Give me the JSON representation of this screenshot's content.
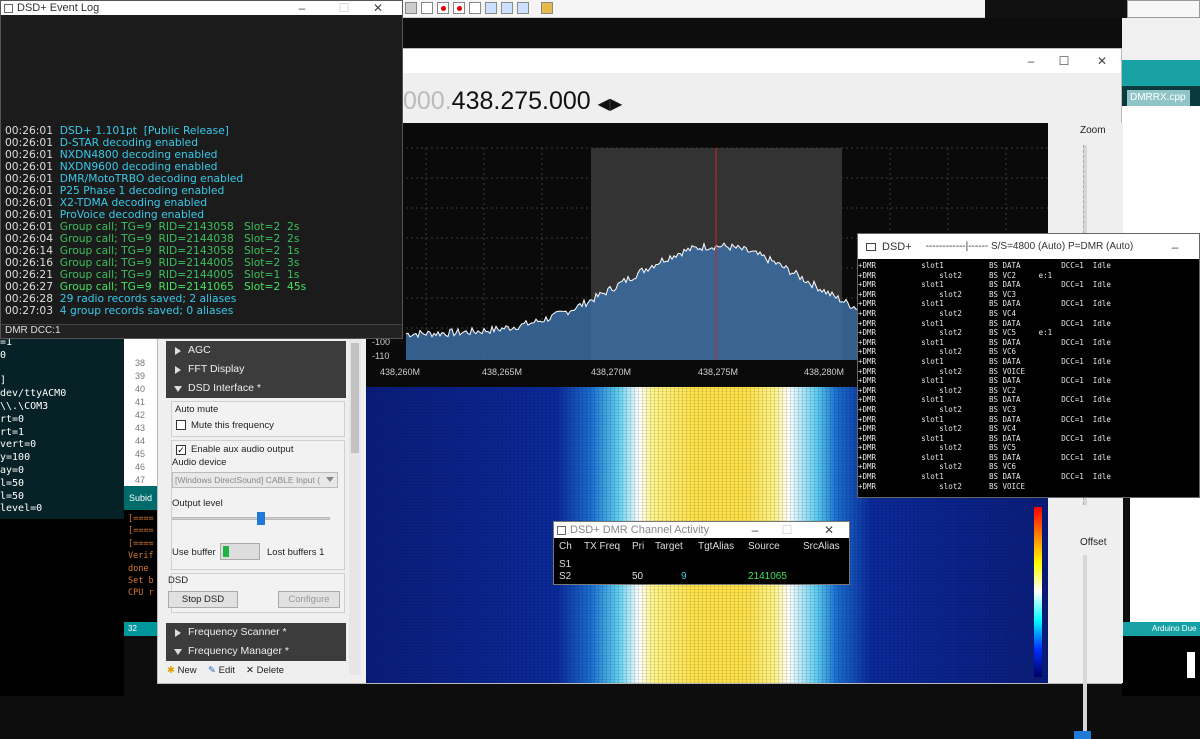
{
  "event_log": {
    "title": "DSD+ Event Log",
    "lines": [
      {
        "t": "00:26:01",
        "m": "DSD+ 1.101pt  [Public Release]",
        "c": "#38c9e8"
      },
      {
        "t": "00:26:01",
        "m": "D-STAR decoding enabled",
        "c": "#38c9e8"
      },
      {
        "t": "00:26:01",
        "m": "NXDN4800 decoding enabled",
        "c": "#38c9e8"
      },
      {
        "t": "00:26:01",
        "m": "NXDN9600 decoding enabled",
        "c": "#38c9e8"
      },
      {
        "t": "00:26:01",
        "m": "DMR/MotoTRBO decoding enabled",
        "c": "#38c9e8"
      },
      {
        "t": "00:26:01",
        "m": "P25 Phase 1 decoding enabled",
        "c": "#38c9e8"
      },
      {
        "t": "00:26:01",
        "m": "X2-TDMA decoding enabled",
        "c": "#38c9e8"
      },
      {
        "t": "00:26:01",
        "m": "ProVoice decoding enabled",
        "c": "#38c9e8"
      },
      {
        "t": "00:26:01",
        "m": "Group call; TG=9  RID=2143058   Slot=2  2s",
        "c": "#3bbf5c"
      },
      {
        "t": "00:26:04",
        "m": "Group call; TG=9  RID=2144038   Slot=2  2s",
        "c": "#3bbf5c"
      },
      {
        "t": "00:26:14",
        "m": "Group call; TG=9  RID=2143058   Slot=2  1s",
        "c": "#3bbf5c"
      },
      {
        "t": "00:26:16",
        "m": "Group call; TG=9  RID=2144005   Slot=2  3s",
        "c": "#3bbf5c"
      },
      {
        "t": "00:26:21",
        "m": "Group call; TG=9  RID=2144005   Slot=1  1s",
        "c": "#3bbf5c"
      },
      {
        "t": "00:26:27",
        "m": "Group call; TG=9  RID=2141065   Slot=2  45s",
        "c": "#46e060"
      },
      {
        "t": "00:26:28",
        "m": "29 radio records saved; 2 aliases",
        "c": "#38c9e8"
      },
      {
        "t": "00:27:03",
        "m": "4 group records saved; 0 aliases",
        "c": "#38c9e8"
      }
    ],
    "status": "DMR  DCC:1"
  },
  "terminal_lines": [
    "=1",
    "0",
    "",
    "]",
    "dev/ttyACM0",
    "\\\\.\\COM3",
    "rt=0",
    "rt=1",
    "vert=0",
    "y=100",
    "ay=0",
    "l=50",
    "l=50",
    "level=0"
  ],
  "editor_line_numbers": [
    "38",
    "39",
    "40",
    "41",
    "42",
    "43",
    "44",
    "45",
    "46",
    "47"
  ],
  "editor_tab": "Subid",
  "serial_lines": [
    "[====",
    "[====",
    "[====",
    "Verif",
    "done",
    "Set b",
    "CPU r"
  ],
  "serial_status": "32",
  "sdr": {
    "frequency_dim": "000.",
    "frequency": "438.275.000",
    "zoom_label": "Zoom",
    "offset_label": "Offset",
    "y_axis_labels": [
      "-100",
      "-110"
    ],
    "x_axis_labels": [
      "438,260M",
      "438,265M",
      "438,270M",
      "438,275M",
      "438,280M"
    ],
    "panel": {
      "agc": "AGC",
      "fft": "FFT Display",
      "dsd": "DSD Interface *",
      "auto_mute": "Auto mute",
      "mute_freq": "Mute this frequency",
      "aux_audio": "Enable aux audio output",
      "audio_device": "Audio device",
      "audio_device_value": "[Windows DirectSound] CABLE Input (",
      "output_level": "Output level",
      "use_buffer": "Use buffer",
      "lost_buffers": "Lost buffers 1",
      "dsd_group": "DSD",
      "stop_dsd": "Stop DSD",
      "configure": "Configure",
      "freq_scanner": "Frequency Scanner *",
      "freq_manager": "Frequency Manager *",
      "new": "New",
      "edit": "Edit",
      "delete": "Delete"
    }
  },
  "ide_tab": "DMRRX.cpp",
  "ide_status": "Arduino Due",
  "dsd_console": {
    "title": "DSD+",
    "subtitle": "------------|------  S/S=4800 (Auto) P=DMR (Auto)",
    "lines": [
      "+DMR          slot1          BS DATA         DCC=1  Idle",
      "+DMR              slot2      BS VC2     e:1",
      "+DMR          slot1          BS DATA         DCC=1  Idle",
      "+DMR              slot2      BS VC3",
      "+DMR          slot1          BS DATA         DCC=1  Idle",
      "+DMR              slot2      BS VC4",
      "+DMR          slot1          BS DATA         DCC=1  Idle",
      "+DMR              slot2      BS VC5     e:1",
      "+DMR          slot1          BS DATA         DCC=1  Idle",
      "+DMR              slot2      BS VC6",
      "+DMR          slot1          BS DATA         DCC=1  Idle",
      "+DMR              slot2      BS VOICE",
      "+DMR          slot1          BS DATA         DCC=1  Idle",
      "+DMR              slot2      BS VC2",
      "+DMR          slot1          BS DATA         DCC=1  Idle",
      "+DMR              slot2      BS VC3",
      "+DMR          slot1          BS DATA         DCC=1  Idle",
      "+DMR              slot2      BS VC4",
      "+DMR          slot1          BS DATA         DCC=1  Idle",
      "+DMR              slot2      BS VC5",
      "+DMR          slot1          BS DATA         DCC=1  Idle",
      "+DMR              slot2      BS VC6",
      "+DMR          slot1          BS DATA         DCC=1  Idle",
      "+DMR              slot2      BS VOICE"
    ]
  },
  "dmr_activity": {
    "title": "DSD+ DMR Channel Activity",
    "headers": [
      "Ch",
      "TX Freq",
      "Pri",
      "Target",
      "TgtAlias",
      "Source",
      "SrcAlias"
    ],
    "rows": [
      {
        "ch": "S1",
        "pri": "",
        "target": "",
        "source": ""
      },
      {
        "ch": "S2",
        "pri": "50",
        "target": "9",
        "source": "2141065"
      }
    ]
  }
}
